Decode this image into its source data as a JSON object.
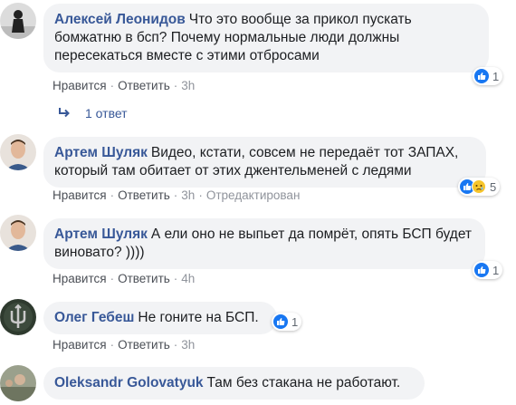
{
  "comments": [
    {
      "author": "Алексей Леонидов",
      "text": "Что это вообще за прикол пускать бомжатню в бсп? Почему нормальные люди должны пересекаться вместе с этими отбросами",
      "like_label": "Нравится",
      "reply_label": "Ответить",
      "time": "3h",
      "reactions": [
        "like"
      ],
      "reaction_count": "1",
      "replies_label": "1 ответ"
    },
    {
      "author": "Артем Шуляк",
      "text": "Видео, кстати, совсем не передаёт тот ЗАПАХ, который там обитает от этих джентельменей с ледями",
      "like_label": "Нравится",
      "reply_label": "Ответить",
      "time": "3h",
      "edited_label": "Отредактирован",
      "reactions": [
        "like",
        "sad"
      ],
      "reaction_count": "5"
    },
    {
      "author": "Артем Шуляк",
      "text": "А ели оно не выпьет да помрёт, опять БСП будет виновато? ))))",
      "like_label": "Нравится",
      "reply_label": "Ответить",
      "time": "4h",
      "reactions": [
        "like"
      ],
      "reaction_count": "1"
    },
    {
      "author": "Олег Гебеш",
      "text": "Не гоните на БСП.",
      "like_label": "Нравится",
      "reply_label": "Ответить",
      "time": "3h",
      "reactions": [
        "like"
      ],
      "reaction_count": "1"
    },
    {
      "author": "Oleksandr Golovatyuk",
      "text": "Там без стакана не работают."
    }
  ],
  "colors": {
    "author": "#385898",
    "bubble": "#f2f3f5",
    "like": "#1877f2",
    "sad": "#f7c52c"
  }
}
